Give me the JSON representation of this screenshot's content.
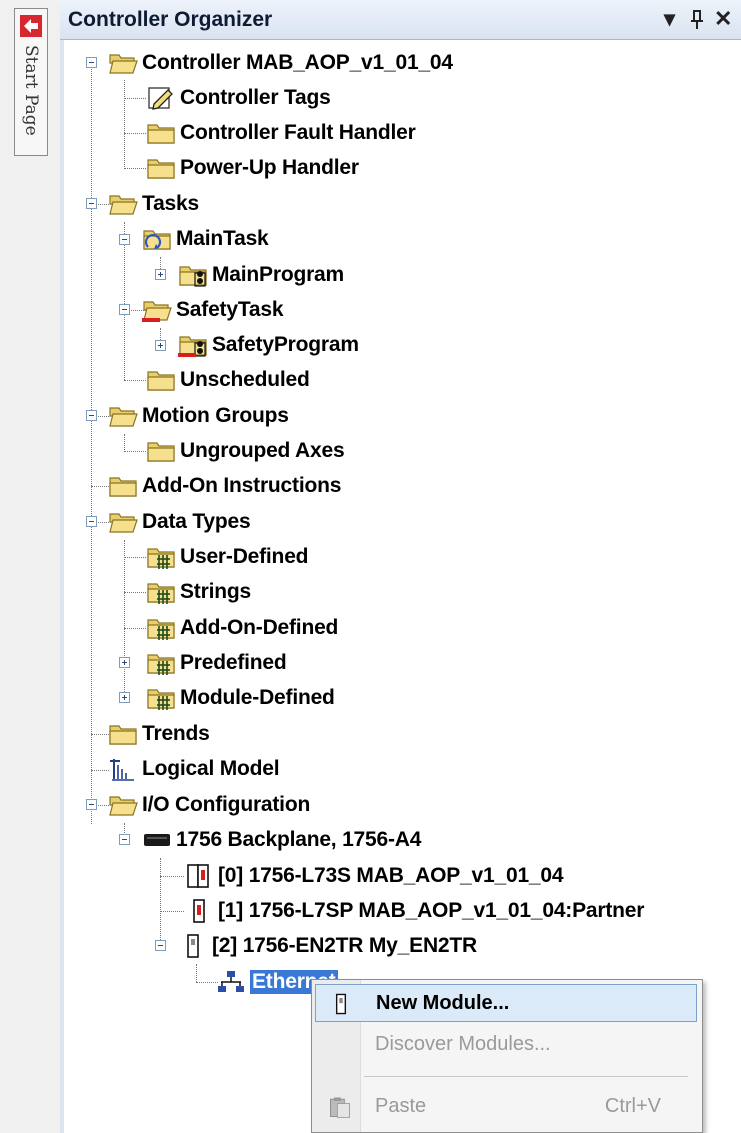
{
  "start_page": {
    "label": "Start Page"
  },
  "panel": {
    "title": "Controller Organizer",
    "dropdown_glyph": "▾",
    "pin_glyph": "ᵖ",
    "close_glyph": "✕"
  },
  "tree": {
    "controller": "Controller MAB_AOP_v1_01_04",
    "controller_tags": "Controller Tags",
    "fault_handler": "Controller Fault Handler",
    "powerup_handler": "Power-Up Handler",
    "tasks": "Tasks",
    "main_task": "MainTask",
    "main_program": "MainProgram",
    "safety_task": "SafetyTask",
    "safety_program": "SafetyProgram",
    "unscheduled": "Unscheduled",
    "motion_groups": "Motion Groups",
    "ungrouped_axes": "Ungrouped Axes",
    "addon_instructions": "Add-On Instructions",
    "data_types": "Data Types",
    "user_defined": "User-Defined",
    "strings": "Strings",
    "addon_defined": "Add-On-Defined",
    "predefined": "Predefined",
    "module_defined": "Module-Defined",
    "trends": "Trends",
    "logical_model": "Logical Model",
    "io_config": "I/O Configuration",
    "backplane": "1756 Backplane, 1756-A4",
    "slot0": "[0] 1756-L73S MAB_AOP_v1_01_04",
    "slot1": "[1] 1756-L7SP MAB_AOP_v1_01_04:Partner",
    "slot2": "[2] 1756-EN2TR My_EN2TR",
    "ethernet": "Ethernet"
  },
  "context_menu": {
    "new_module": "New Module...",
    "discover_modules": "Discover Modules...",
    "paste": "Paste",
    "paste_shortcut": "Ctrl+V"
  }
}
